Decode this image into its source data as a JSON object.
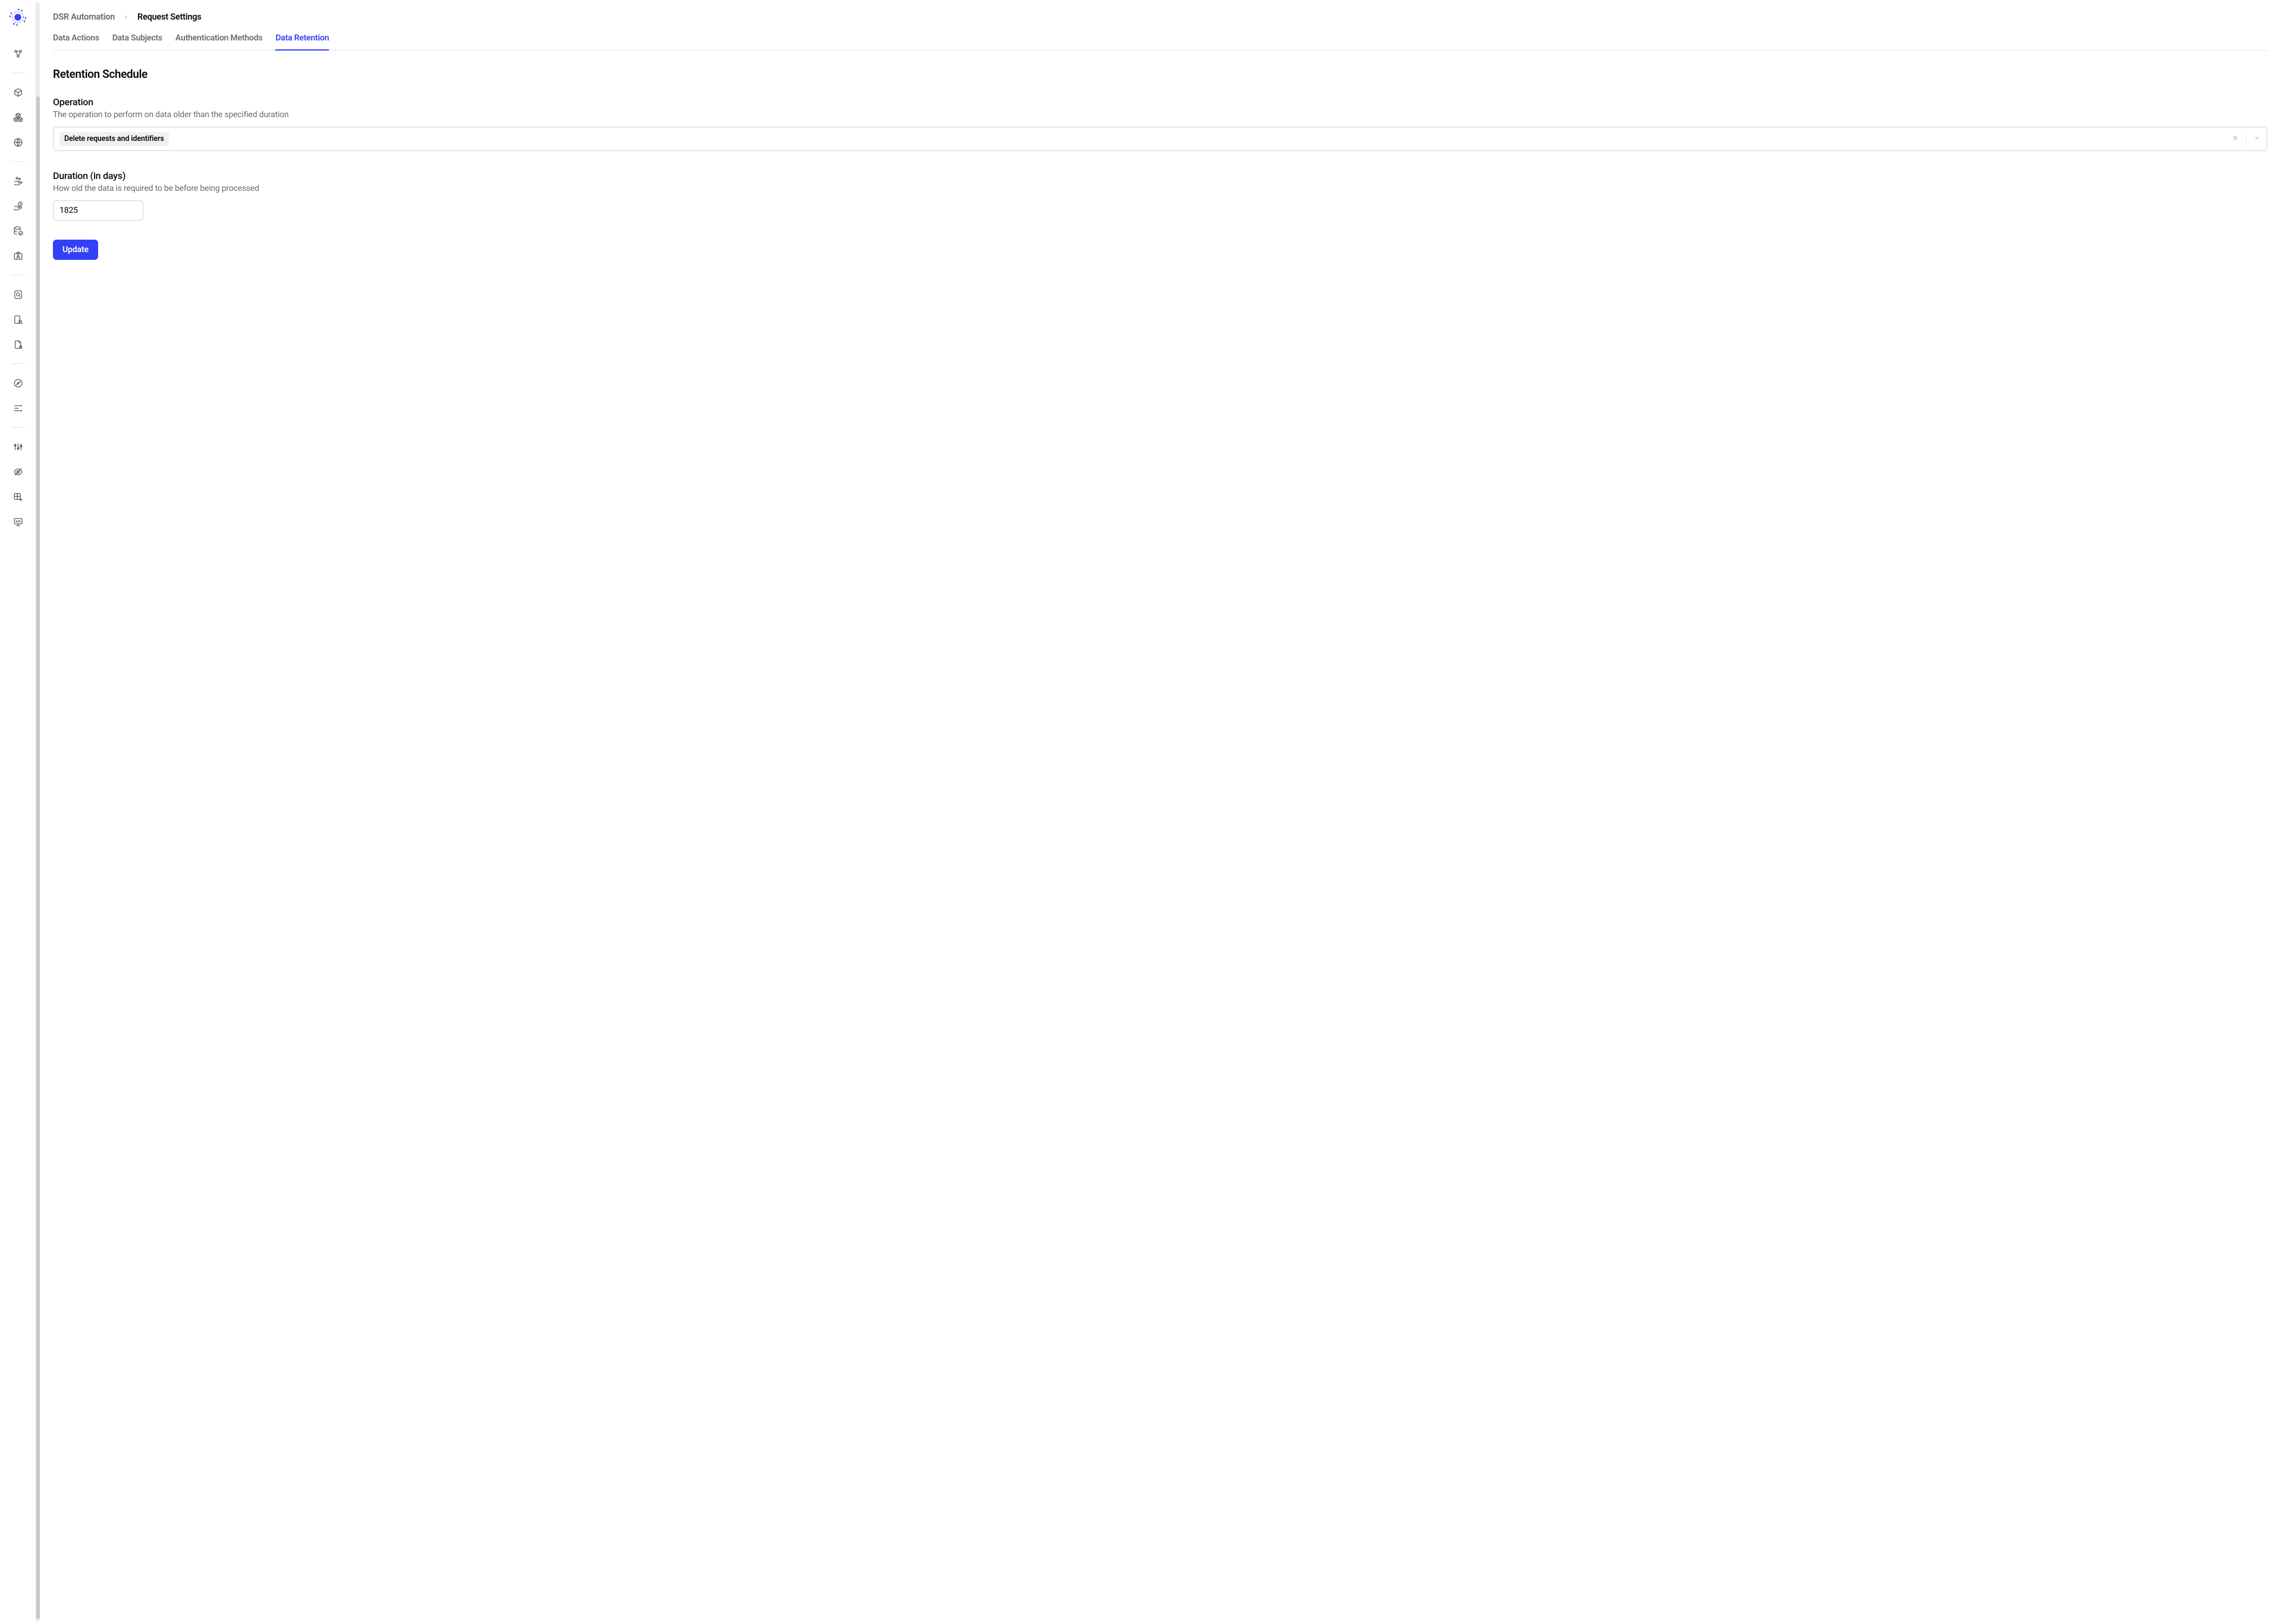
{
  "breadcrumb": {
    "parent": "DSR Automation",
    "current": "Request Settings"
  },
  "tabs": [
    {
      "label": "Data Actions",
      "active": false
    },
    {
      "label": "Data Subjects",
      "active": false
    },
    {
      "label": "Authentication Methods",
      "active": false
    },
    {
      "label": "Data Retention",
      "active": true
    }
  ],
  "section": {
    "title": "Retention Schedule"
  },
  "operation": {
    "label": "Operation",
    "help": "The operation to perform on data older than the specified duration",
    "selected": "Delete requests and identifiers"
  },
  "duration": {
    "label": "Duration (in days)",
    "help": "How old the data is required to be before being processed",
    "value": "1825"
  },
  "actions": {
    "update": "Update"
  },
  "sidebar": {
    "icons": [
      "network-icon",
      "cube-icon",
      "cubes-icon",
      "globe-icon",
      "hand-coins-icon",
      "hand-clock-icon",
      "database-check-icon",
      "id-card-icon",
      "search-doc-icon",
      "device-search-icon",
      "file-user-icon",
      "compass-icon",
      "list-filter-icon",
      "sliders-icon",
      "eye-off-icon",
      "table-plus-icon",
      "code-monitor-icon"
    ]
  }
}
